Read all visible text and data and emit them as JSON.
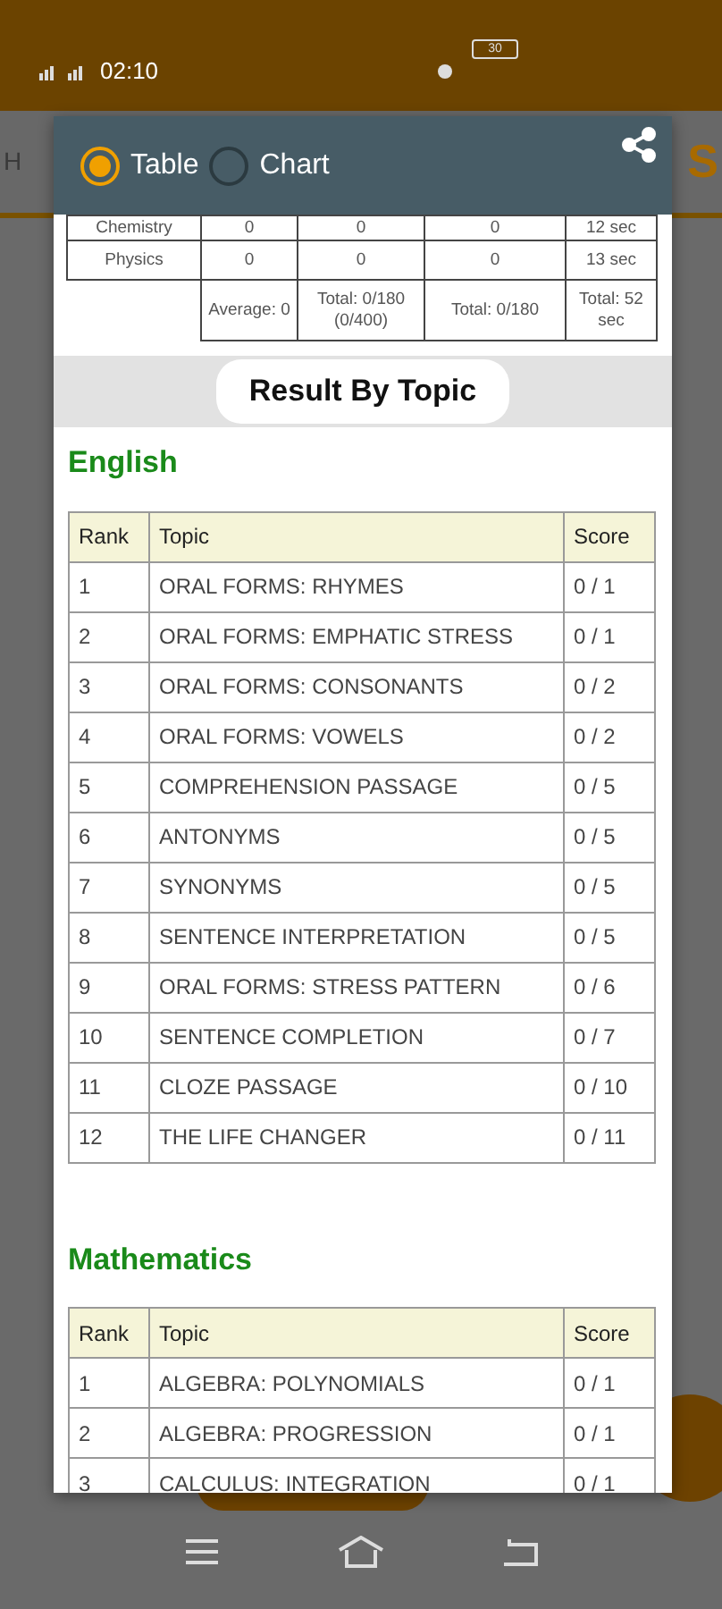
{
  "status_bar": {
    "time": "02:10",
    "battery": "30"
  },
  "background": {
    "tab_left": "H",
    "tab_right": "S"
  },
  "dialog": {
    "options": [
      {
        "label": "Table",
        "selected": true
      },
      {
        "label": "Chart",
        "selected": false
      }
    ],
    "summary": {
      "rows": [
        [
          "Chemistry",
          "0",
          "0",
          "0",
          "12 sec"
        ],
        [
          "Physics",
          "0",
          "0",
          "0",
          "13 sec"
        ]
      ],
      "totals": [
        "Average: 0",
        "Total: 0/180 (0/400)",
        "Total: 0/180",
        "Total: 52 sec"
      ]
    },
    "section_title": "Result By Topic",
    "subjects": [
      {
        "name": "English",
        "columns": [
          "Rank",
          "Topic",
          "Score"
        ],
        "rows": [
          [
            "1",
            "ORAL FORMS: RHYMES",
            "0 / 1"
          ],
          [
            "2",
            "ORAL FORMS: EMPHATIC STRESS",
            "0 / 1"
          ],
          [
            "3",
            "ORAL FORMS: CONSONANTS",
            "0 / 2"
          ],
          [
            "4",
            "ORAL FORMS: VOWELS",
            "0 / 2"
          ],
          [
            "5",
            "COMPREHENSION PASSAGE",
            "0 / 5"
          ],
          [
            "6",
            "ANTONYMS",
            "0 / 5"
          ],
          [
            "7",
            "SYNONYMS",
            "0 / 5"
          ],
          [
            "8",
            "SENTENCE INTERPRETATION",
            "0 / 5"
          ],
          [
            "9",
            "ORAL FORMS: STRESS PATTERN",
            "0 / 6"
          ],
          [
            "10",
            "SENTENCE COMPLETION",
            "0 / 7"
          ],
          [
            "11",
            "CLOZE PASSAGE",
            "0 / 10"
          ],
          [
            "12",
            "THE LIFE CHANGER",
            "0 / 11"
          ]
        ]
      },
      {
        "name": "Mathematics",
        "columns": [
          "Rank",
          "Topic",
          "Score"
        ],
        "rows": [
          [
            "1",
            "ALGEBRA: POLYNOMIALS",
            "0 / 1"
          ],
          [
            "2",
            "ALGEBRA: PROGRESSION",
            "0 / 1"
          ],
          [
            "3",
            "CALCULUS: INTEGRATION",
            "0 / 1"
          ]
        ]
      }
    ]
  }
}
